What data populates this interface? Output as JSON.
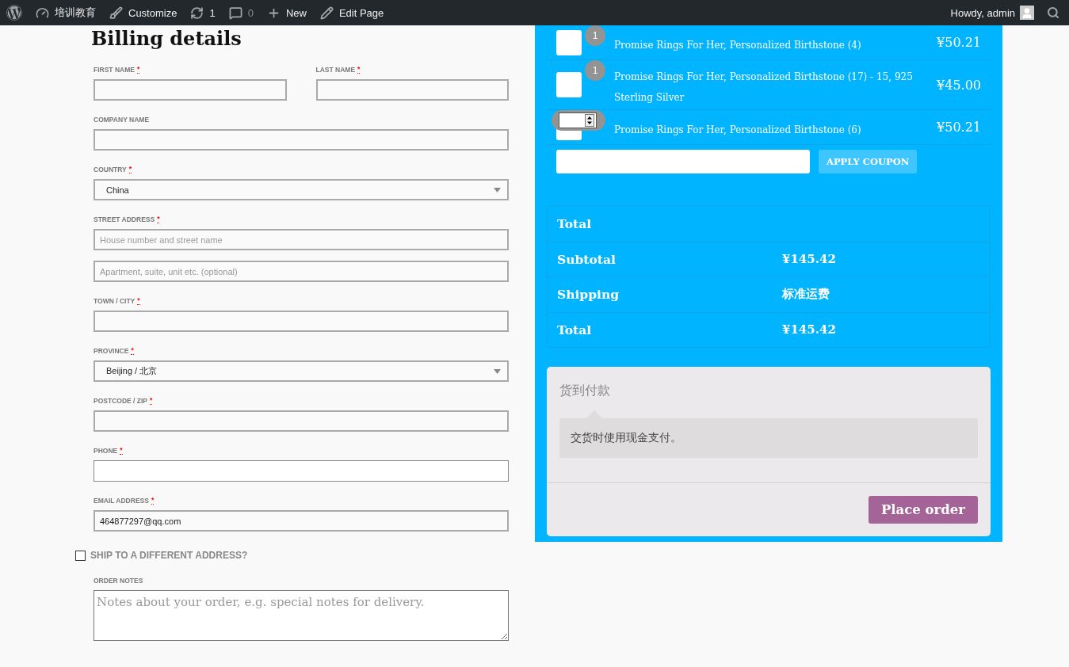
{
  "admin_bar": {
    "items": [
      {
        "label": "培训教育",
        "muted": false
      },
      {
        "label": "Customize",
        "muted": false
      },
      {
        "label": "1",
        "muted": false
      },
      {
        "label": "0",
        "muted": true
      },
      {
        "label": "New",
        "muted": false
      },
      {
        "label": "Edit Page",
        "muted": false
      }
    ],
    "greeting": "Howdy, admin"
  },
  "billing": {
    "title": "Billing details",
    "rows": [
      [
        {
          "label": "FIRST NAME",
          "required_mark": "*",
          "kind": "text",
          "focused": false
        },
        {
          "label": "LAST NAME",
          "required_mark": "*",
          "kind": "text",
          "focused": false
        }
      ],
      [
        {
          "label": "COMPANY NAME",
          "kind": "text",
          "focused": false
        }
      ],
      [
        {
          "label": "COUNTRY",
          "required_mark": "*",
          "kind": "select",
          "value": "China"
        }
      ],
      [
        {
          "label": "STREET ADDRESS",
          "required_mark": "*",
          "kind": "lines",
          "lines": [
            {
              "placeholder": "House number and street name"
            },
            {
              "placeholder": "Apartment, suite, unit etc. (optional)"
            }
          ]
        }
      ],
      [
        {
          "label": "TOWN / CITY",
          "required_mark": "*",
          "kind": "text",
          "focused": false
        }
      ],
      [
        {
          "label": "PROVINCE",
          "required_mark": "*",
          "kind": "select",
          "value": "Beijing / 北京"
        }
      ],
      [
        {
          "label": "POSTCODE / ZIP",
          "required_mark": "*",
          "kind": "text",
          "focused": false
        }
      ],
      [
        {
          "label": "PHONE",
          "required_mark": "*",
          "kind": "text",
          "focused": true
        }
      ],
      [
        {
          "label": "EMAIL ADDRESS",
          "required_mark": "*",
          "kind": "text",
          "focused": false,
          "value": "464877297@qq.com"
        }
      ]
    ],
    "ship_different": {
      "label": "SHIP TO A DIFFERENT ADDRESS?",
      "checked": false
    },
    "order_notes": {
      "label": "ORDER NOTES",
      "placeholder": "Notes about your order, e.g. special notes for delivery."
    }
  },
  "cart": {
    "items": [
      {
        "name": "Promise Rings For Her, Personalized Birthstone (4)",
        "price": "¥50.21",
        "kind": "badge",
        "quantity": "1"
      },
      {
        "name": "Promise Rings For Her, Personalized Birthstone (17) - 15, 925 Sterling Silver",
        "price": "¥45.00",
        "kind": "badge",
        "quantity": "1"
      },
      {
        "name": "Promise Rings For Her, Personalized Birthstone (6)",
        "price": "¥50.21",
        "kind": "spinner"
      }
    ],
    "coupon_button": "APPLY COUPON"
  },
  "totals": {
    "rows": [
      {
        "label": "Total"
      },
      {
        "label": "Subtotal",
        "value": "¥145.42"
      },
      {
        "label": "Shipping",
        "value": "标准运费"
      },
      {
        "label": "Total",
        "value": "¥145.42"
      }
    ]
  },
  "payment": {
    "method": "货到付款",
    "description": "交货时使用现金支付。",
    "button": "Place order"
  }
}
